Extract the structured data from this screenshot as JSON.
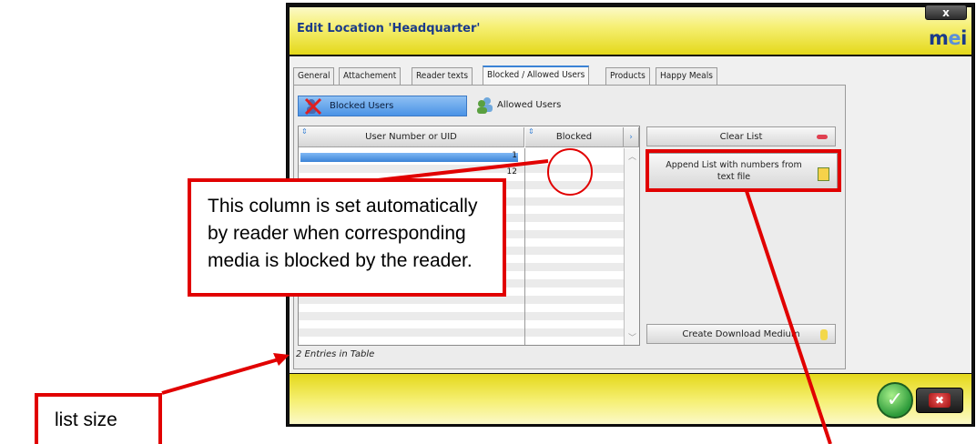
{
  "dialog": {
    "title": "Edit Location 'Headquarter'",
    "close_label": "x",
    "logo": {
      "left": "m",
      "right": "i",
      "e": "e"
    }
  },
  "tabs": [
    {
      "label": "General"
    },
    {
      "label": "Attachement"
    },
    {
      "label": "Reader texts"
    },
    {
      "label": "Blocked / Allowed Users",
      "active": true
    },
    {
      "label": "Products"
    },
    {
      "label": "Happy Meals"
    }
  ],
  "toggles": {
    "blocked_users": "Blocked Users",
    "allowed_users": "Allowed Users"
  },
  "table": {
    "columns": [
      "User Number or UID",
      "Blocked"
    ],
    "rows": [
      {
        "uid": "1",
        "blocked": ""
      },
      {
        "uid": "12",
        "blocked": ""
      }
    ]
  },
  "buttons": {
    "clear_list": "Clear List",
    "append_list": "Append List with numbers from text file",
    "create_download_medium": "Create Download Medium"
  },
  "status": "2 Entries in Table",
  "annotations": {
    "column_note": "This column is set automatically by reader when corresponding media is blocked by the reader.",
    "list_size": "list size"
  },
  "colors": {
    "title_bar": "#f6f076",
    "accent_blue": "#3b83d6",
    "annotation_red": "#e10000",
    "ok_green": "#2c9a3a",
    "cancel_red": "#c01515"
  },
  "icons": {
    "blocked_users": "blocked-users-icon",
    "allowed_users": "allowed-users-icon",
    "clear_list": "eraser-icon",
    "append_list": "text-file-icon",
    "download": "medium-icon",
    "ok": "checkmark-icon",
    "cancel": "x-icon"
  }
}
